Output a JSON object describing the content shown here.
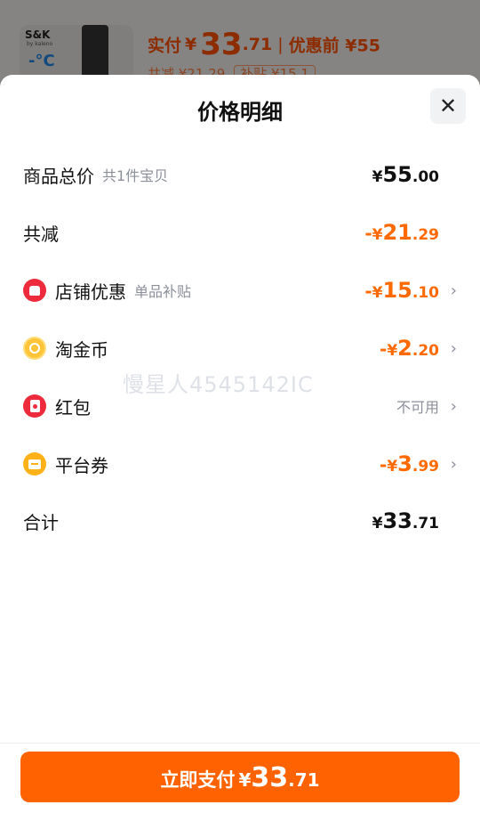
{
  "background": {
    "brand": "S&K",
    "brand_sub": "by kaleno",
    "temp": "-°C",
    "price_label": "实付",
    "price_yen": "¥",
    "price_int": "33",
    "price_dec": ".71",
    "orig_label": "优惠前 ¥55",
    "sub_text": "共减 ¥21.29",
    "sub_tag": "补贴 ¥15.1"
  },
  "sheet": {
    "title": "价格明细",
    "close_icon": "close-icon"
  },
  "rows": {
    "total": {
      "label": "商品总价",
      "sublabel": "共1件宝贝",
      "yen": "¥",
      "int": "55",
      "dec": ".00"
    },
    "reduction": {
      "label": "共减",
      "sign": "-",
      "yen": "¥",
      "int": "21",
      "dec": ".29"
    },
    "shop": {
      "label": "店铺优惠",
      "sublabel": "单品补贴",
      "sign": "-",
      "yen": "¥",
      "int": "15",
      "dec": ".10",
      "icon": "shop-discount-icon"
    },
    "coin": {
      "label": "淘金币",
      "sign": "-",
      "yen": "¥",
      "int": "2",
      "dec": ".20",
      "icon": "gold-coin-icon"
    },
    "redpack": {
      "label": "红包",
      "status": "不可用",
      "icon": "red-packet-icon"
    },
    "coupon": {
      "label": "平台券",
      "sign": "-",
      "yen": "¥",
      "int": "3",
      "dec": ".99",
      "icon": "coupon-icon"
    },
    "sum": {
      "label": "合计",
      "yen": "¥",
      "int": "33",
      "dec": ".71"
    }
  },
  "watermark": "慢星人4545142IC",
  "pay_button": {
    "label": "立即支付",
    "yen": "¥",
    "int": "33",
    "dec": ".71"
  },
  "colors": {
    "accent": "#ff6200",
    "discount": "#ff6a00",
    "text": "#111111",
    "muted": "#8b8f99"
  }
}
